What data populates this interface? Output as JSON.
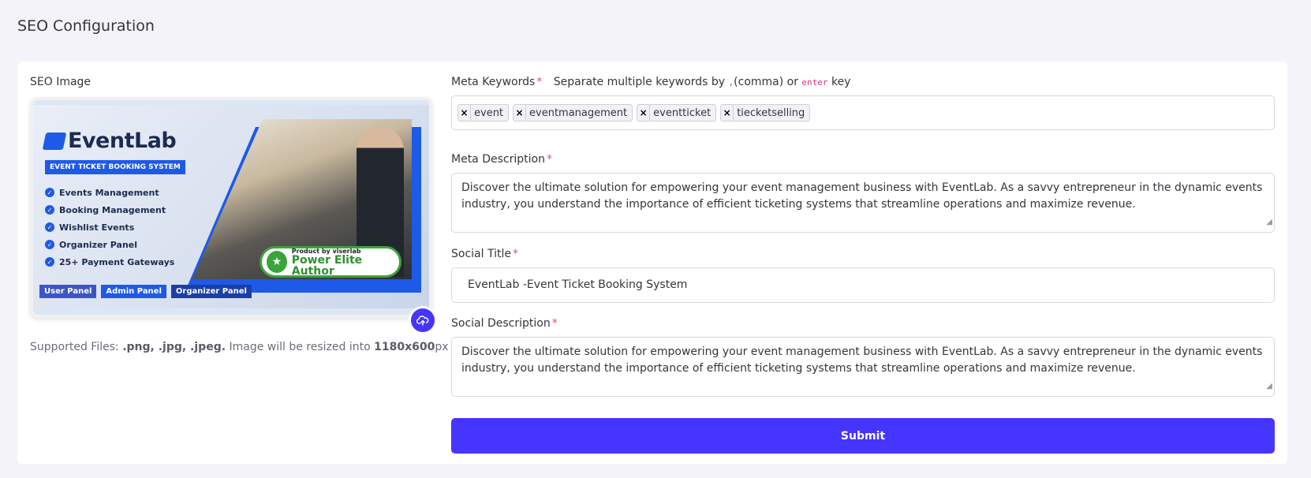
{
  "page": {
    "title": "SEO Configuration"
  },
  "seo_image": {
    "label": "SEO Image",
    "banner": {
      "brand": "EventLab",
      "tagline": "EVENT TICKET BOOKING SYSTEM",
      "features": [
        "Events Management",
        "Booking Management",
        "Wishlist Events",
        "Organizer Panel",
        "25+ Payment Gateways"
      ],
      "badge_small": "Product by viserlab",
      "badge_big": "Power Elite Author",
      "panels": [
        "User Panel",
        "Admin Panel",
        "Organizer Panel"
      ]
    },
    "upload_icon": "cloud-upload-icon",
    "support_prefix": "Supported Files: ",
    "support_types": ".png, .jpg, .jpeg.",
    "support_mid": " Image will be resized into ",
    "support_size": "1180x600",
    "support_suffix": "px"
  },
  "meta_keywords": {
    "label": "Meta Keywords",
    "required": "*",
    "help_prefix": "Separate multiple keywords by ",
    "help_code1": ",",
    "help_mid": "(comma) or ",
    "help_code2": "enter",
    "help_suffix": " key",
    "tags": [
      "event",
      "eventmanagement",
      "eventticket",
      "tiecketselling"
    ],
    "remove_symbol": "×"
  },
  "meta_description": {
    "label": "Meta Description",
    "required": "*",
    "value": "Discover the ultimate solution for empowering your event management business with EventLab. As a savvy entrepreneur in the dynamic events industry, you understand the importance of efficient ticketing systems that streamline operations and maximize revenue."
  },
  "social_title": {
    "label": "Social Title",
    "required": "*",
    "value": "EventLab -Event Ticket Booking System"
  },
  "social_description": {
    "label": "Social Description",
    "required": "*",
    "value": "Discover the ultimate solution for empowering your event management business with EventLab. As a savvy entrepreneur in the dynamic events industry, you understand the importance of efficient ticketing systems that streamline operations and maximize revenue."
  },
  "submit_label": "Submit",
  "colors": {
    "primary": "#4634ff",
    "required": "#ea5455",
    "background": "#f3f3f9"
  }
}
